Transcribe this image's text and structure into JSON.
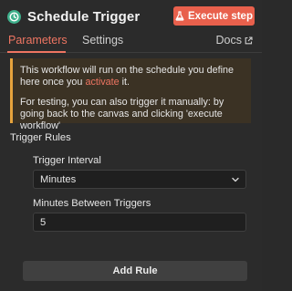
{
  "header": {
    "title": "Schedule Trigger",
    "icon": "clock-icon",
    "execute_label": "Execute step",
    "execute_icon": "flask-icon"
  },
  "tabs": {
    "parameters": "Parameters",
    "settings": "Settings",
    "docs": "Docs",
    "docs_icon": "external-link-icon",
    "active": "Parameters"
  },
  "notice": {
    "line1_before": "This workflow will run on the schedule you define here once you ",
    "line1_link": "activate",
    "line1_after": " it.",
    "line2": "For testing, you can also trigger it manually: by going back to the canvas and clicking 'execute workflow'"
  },
  "trigger_rules": {
    "section_label": "Trigger Rules",
    "interval_label": "Trigger Interval",
    "interval_value": "Minutes",
    "minutes_label": "Minutes Between Triggers",
    "minutes_value": "5",
    "add_rule_label": "Add Rule"
  },
  "colors": {
    "accent": "#ee7562",
    "execute_button": "#e8604c",
    "node_icon": "#3fb08c",
    "notice_border": "#e6a33c",
    "background": "#2b2b2b"
  }
}
